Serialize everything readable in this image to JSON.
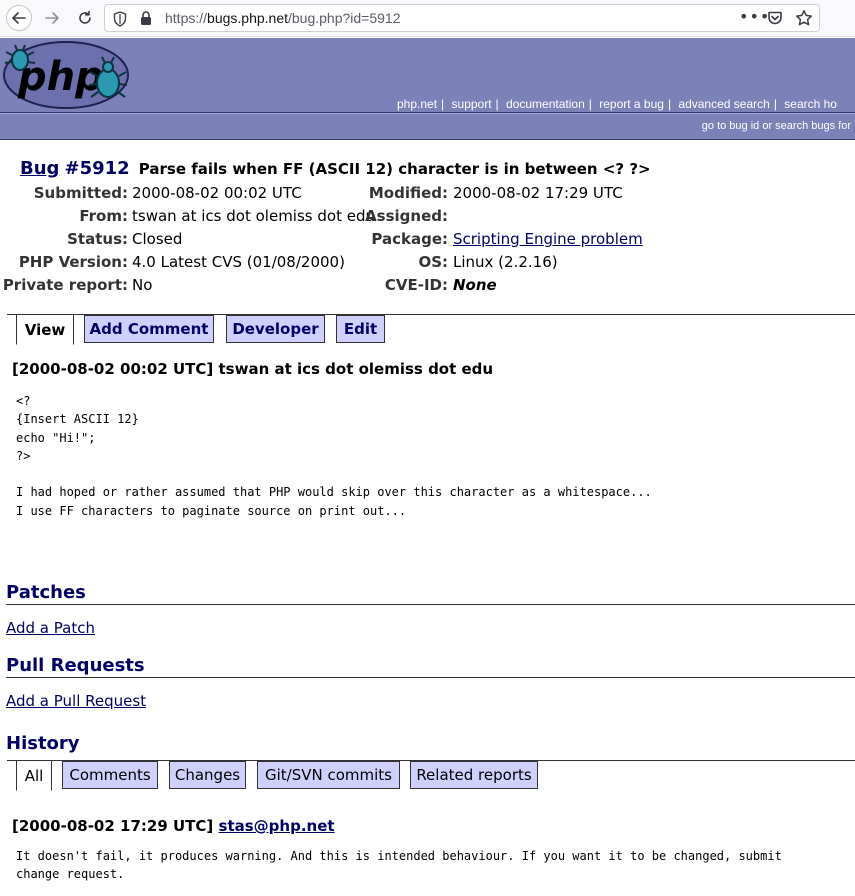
{
  "browser": {
    "url_prefix": "https://",
    "url_host": "bugs.php.net",
    "url_path": "/bug.php?id=5912",
    "dots": "•••"
  },
  "header": {
    "logo_text": "php",
    "links": [
      {
        "label": "php.net"
      },
      {
        "label": "support"
      },
      {
        "label": "documentation"
      },
      {
        "label": "report a bug"
      },
      {
        "label": "advanced search"
      },
      {
        "label": "search ho"
      }
    ],
    "separator": "|",
    "subbar_text": "go to bug id or search bugs for"
  },
  "bug": {
    "link_label": "Bug",
    "number": "#5912",
    "summary": "Parse fails when FF (ASCII 12) character is in between <? ?>",
    "submitted_label": "Submitted:",
    "submitted": "2000-08-02 00:02 UTC",
    "modified_label": "Modified:",
    "modified": "2000-08-02 17:29 UTC",
    "from_label": "From:",
    "from": "tswan at ics dot olemiss dot edu",
    "assigned_label": "Assigned:",
    "assigned": "",
    "status_label": "Status:",
    "status": "Closed",
    "package_label": "Package:",
    "package": "Scripting Engine problem",
    "php_version_label": "PHP Version:",
    "php_version": "4.0 Latest CVS (01/08/2000)",
    "os_label": "OS:",
    "os": "Linux (2.2.16)",
    "private_label": "Private report:",
    "private": "No",
    "cve_label": "CVE-ID:",
    "cve": "None"
  },
  "tabs": [
    {
      "label": "View",
      "active": true
    },
    {
      "label": "Add Comment",
      "active": false
    },
    {
      "label": "Developer",
      "active": false
    },
    {
      "label": "Edit",
      "active": false
    }
  ],
  "first_comment": {
    "header": "[2000-08-02 00:02 UTC] tswan at ics dot olemiss dot edu",
    "body": "<?\n{Insert ASCII 12}\necho \"Hi!\";\n?>\n\nI had hoped or rather assumed that PHP would skip over this character as a whitespace...\nI use FF characters to paginate source on print out..."
  },
  "patches": {
    "title": "Patches",
    "link": "Add a Patch"
  },
  "pull_requests": {
    "title": "Pull Requests",
    "link": "Add a Pull Request"
  },
  "history": {
    "title": "History",
    "tabs": [
      {
        "label": "All",
        "active": true
      },
      {
        "label": "Comments",
        "active": false
      },
      {
        "label": "Changes",
        "active": false
      },
      {
        "label": "Git/SVN commits",
        "active": false
      },
      {
        "label": "Related reports",
        "active": false
      }
    ]
  },
  "second_comment": {
    "date": "[2000-08-02 17:29 UTC]",
    "author": "stas@php.net",
    "body": "It doesn't fail, it produces warning. And this is intended behaviour. If you want it to be changed, submit\nchange request."
  }
}
